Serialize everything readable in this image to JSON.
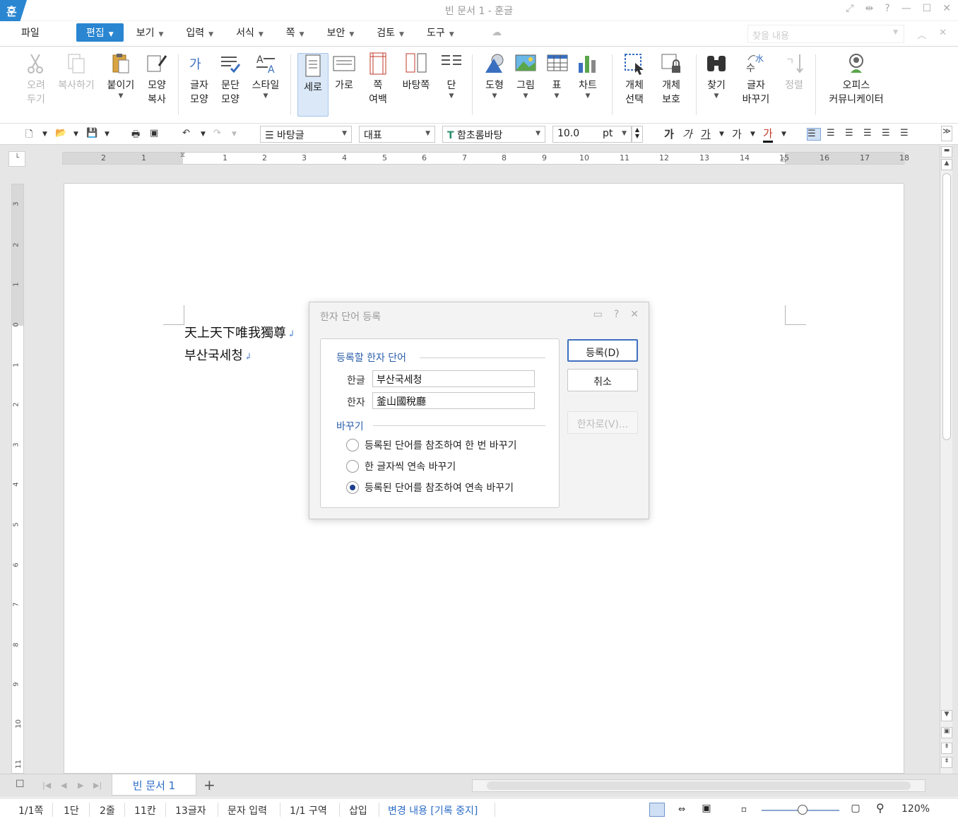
{
  "app": {
    "logo": "훈",
    "title": "빈 문서 1 - 훈글"
  },
  "menu": {
    "file": "파일",
    "items": [
      "편집",
      "보기",
      "입력",
      "서식",
      "쪽",
      "보안",
      "검토",
      "도구"
    ],
    "active": "편집",
    "find_placeholder": "찾을 내용"
  },
  "ribbon": {
    "cut": "오려\n두기",
    "copy": "복사하기",
    "paste": "붙이기",
    "format_copy": "모양\n복사",
    "char_shape": "글자\n모양",
    "para_shape": "문단\n모양",
    "style": "스타일",
    "vertical": "세로",
    "horizontal": "가로",
    "page_margin": "쪽\n여백",
    "master_page": "바탕쪽",
    "columns": "단",
    "shape": "도형",
    "picture": "그림",
    "table": "표",
    "chart": "차트",
    "select_object": "개체\n선택",
    "protect_object": "개체\n보호",
    "find": "찾기",
    "replace_char": "글자\n바꾸기",
    "sort": "정렬",
    "office_communicator": "오피스\n커뮤니케이터"
  },
  "format": {
    "style": "바탕글",
    "lang": "대표",
    "font": "함초롬바탕",
    "size": "10.0",
    "unit": "pt",
    "bold": "가",
    "italic": "가",
    "underline": "가",
    "strike": "가",
    "color": "가"
  },
  "ruler": {
    "h_ticks": [
      "2",
      "1",
      "1",
      "2",
      "3",
      "4",
      "5",
      "6",
      "7",
      "8",
      "9",
      "10",
      "11",
      "12",
      "13",
      "14",
      "15",
      "16",
      "17",
      "18"
    ],
    "v_ticks": [
      "3",
      "2",
      "1",
      "0",
      "1",
      "2",
      "3",
      "4",
      "5",
      "6",
      "7",
      "8",
      "9",
      "10",
      "11"
    ]
  },
  "document": {
    "lines": [
      "天上天下唯我獨尊",
      "부산국세청"
    ],
    "para_mark": "↲"
  },
  "dialog": {
    "title": "한자 단어 등록",
    "group_register": "등록할 한자 단어",
    "hangul_label": "한글",
    "hangul_value": "부산국세청",
    "hanja_label": "한자",
    "hanja_value": "釜山國稅廳",
    "group_replace": "바꾸기",
    "options": [
      "등록된 단어를 참조하여 한 번 바꾸기",
      "한 글자씩 연속 바꾸기",
      "등록된 단어를 참조하여 연속 바꾸기"
    ],
    "selected_option": 2,
    "btn_register": "등록(D)",
    "btn_cancel": "취소",
    "btn_to_hanja": "한자로(V)..."
  },
  "tabs": {
    "doc_tab": "빈 문서 1",
    "add": "+"
  },
  "status": {
    "page": "1/1쪽",
    "column": "1단",
    "line": "2줄",
    "col_pos": "11칸",
    "char_count": "13글자",
    "input_mode": "문자 입력",
    "section": "1/1 구역",
    "insert": "삽입",
    "track": "변경 내용 [기록 중지]",
    "zoom": "120%"
  }
}
